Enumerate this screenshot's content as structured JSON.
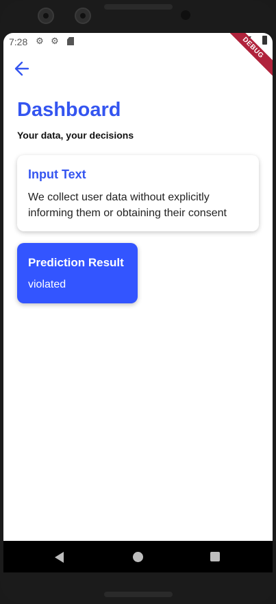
{
  "status_bar": {
    "time": "7:28",
    "icons": [
      "gear-icon",
      "gear-icon",
      "sd-card-icon",
      "wifi-icon",
      "battery-icon"
    ],
    "debug_banner": "DEBUG"
  },
  "app_bar": {
    "back_icon": "arrow-left-icon"
  },
  "page": {
    "title": "Dashboard",
    "subtitle": "Your data, your decisions"
  },
  "input_card": {
    "label": "Input Text",
    "text": "We collect user data without explicitly informing them or obtaining their consent"
  },
  "result_card": {
    "label": "Prediction Result",
    "value": "violated"
  },
  "nav_bar": {
    "buttons": [
      "back-triangle-icon",
      "home-circle-icon",
      "recents-square-icon"
    ]
  },
  "colors": {
    "accent": "#3455f0",
    "result_card_bg": "#3355ff",
    "debug_banner": "#b0233c"
  }
}
